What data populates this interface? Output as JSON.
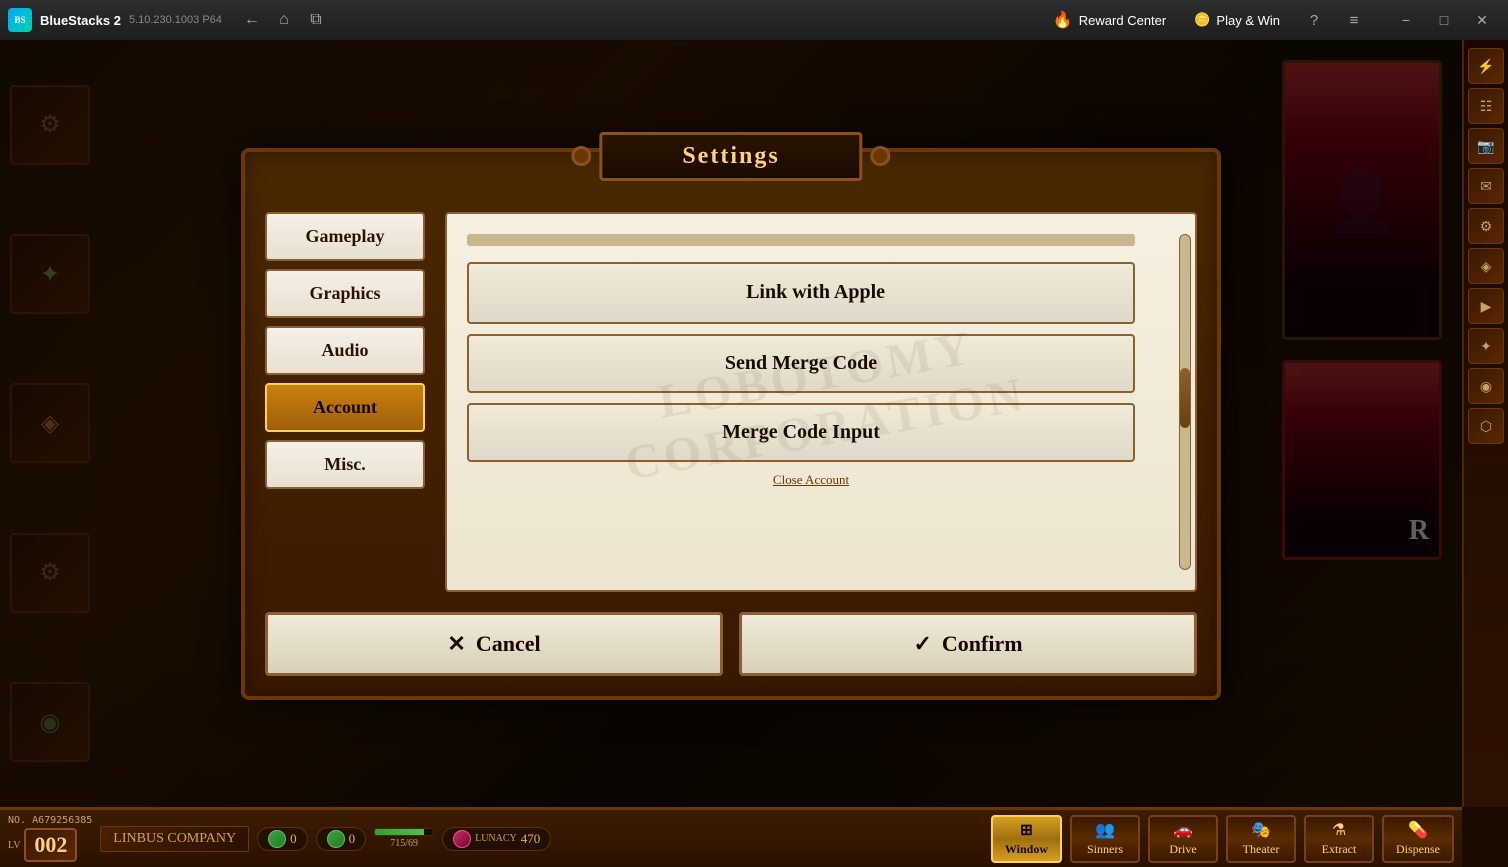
{
  "titlebar": {
    "app_name": "BlueStacks 2",
    "version": "5.10.230.1003  P64",
    "logo_text": "BS",
    "back_icon": "←",
    "home_icon": "⌂",
    "multi_icon": "⧉",
    "reward_center_label": "Reward Center",
    "reward_icon": "🔥",
    "play_win_label": "Play & Win",
    "coin_icon": "🪙",
    "help_icon": "?",
    "menu_icon": "≡",
    "minimize_icon": "−",
    "maximize_icon": "□",
    "close_icon": "✕"
  },
  "settings": {
    "title": "Settings",
    "tabs": [
      {
        "id": "gameplay",
        "label": "Gameplay",
        "active": false
      },
      {
        "id": "graphics",
        "label": "Graphics",
        "active": false
      },
      {
        "id": "audio",
        "label": "Audio",
        "active": false
      },
      {
        "id": "account",
        "label": "Account",
        "active": true
      },
      {
        "id": "misc",
        "label": "Misc.",
        "active": false
      }
    ],
    "account": {
      "link_apple_label": "Link with Apple",
      "send_merge_label": "Send Merge Code",
      "merge_input_label": "Merge Code Input",
      "close_account_label": "Close Account",
      "apple_icon": ""
    },
    "cancel_label": "Cancel",
    "cancel_icon": "✕",
    "confirm_label": "Confirm",
    "confirm_icon": "✓"
  },
  "sidebar": {
    "icons": [
      "⚡",
      "☷",
      "📸",
      "✉",
      "⚙",
      "◈",
      "▶",
      "✦",
      "◉",
      "⬡"
    ]
  },
  "bottom_bar": {
    "player_id": "NO. A679256385",
    "level_prefix": "LV",
    "level": "002",
    "player_name": "LINBUS COMPANY",
    "resource1_value": "0",
    "resource2_value": "0",
    "health_current": "715",
    "health_max": "69",
    "lunacy_label": "LUNACY",
    "lunacy_value": "470",
    "menu_items": [
      {
        "id": "window",
        "label": "Window",
        "active": true
      },
      {
        "id": "sinners",
        "label": "Sinners",
        "active": false
      },
      {
        "id": "drive",
        "label": "Drive",
        "active": false
      },
      {
        "id": "theater",
        "label": "Theater",
        "active": false
      },
      {
        "id": "extract",
        "label": "Extract",
        "active": false
      },
      {
        "id": "dispense",
        "label": "Dispense",
        "active": false
      }
    ]
  },
  "watermark": "LOBOTOMY CORPORATION"
}
